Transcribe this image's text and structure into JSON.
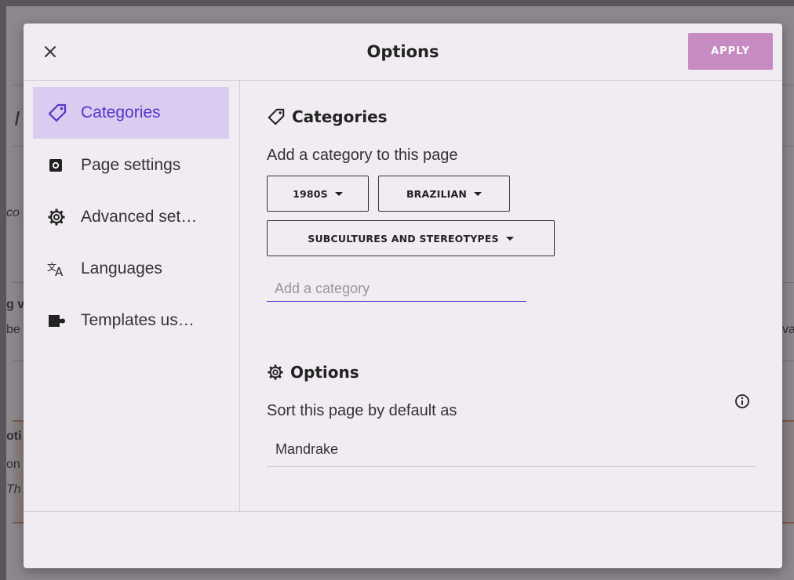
{
  "background": {
    "fragments": [
      "I",
      "co",
      "g v",
      "be",
      "va",
      "oti",
      "on",
      "Th"
    ]
  },
  "dialog": {
    "title": "Options",
    "apply_label": "APPLY",
    "sidebar": {
      "items": [
        {
          "label": "Categories",
          "icon": "tag-icon",
          "active": true
        },
        {
          "label": "Page settings",
          "icon": "page-settings-icon",
          "active": false
        },
        {
          "label": "Advanced set…",
          "icon": "gear-icon",
          "active": false
        },
        {
          "label": "Languages",
          "icon": "language-icon",
          "active": false
        },
        {
          "label": "Templates us…",
          "icon": "puzzle-icon",
          "active": false
        }
      ]
    },
    "categories": {
      "heading": "Categories",
      "prompt": "Add a category to this page",
      "chips": [
        "1980S",
        "BRAZILIAN",
        "SUBCULTURES AND STEREOTYPES"
      ],
      "input_placeholder": "Add a category",
      "input_value": ""
    },
    "options": {
      "heading": "Options",
      "sort_prompt": "Sort this page by default as",
      "sort_value": "Mandrake"
    }
  },
  "colors": {
    "accent": "#5b31c9",
    "active_bg": "#d9ccf0",
    "apply_bg": "#c68bc3",
    "dialog_bg": "#f1ecf2",
    "overlay": "#7d7a7e"
  }
}
